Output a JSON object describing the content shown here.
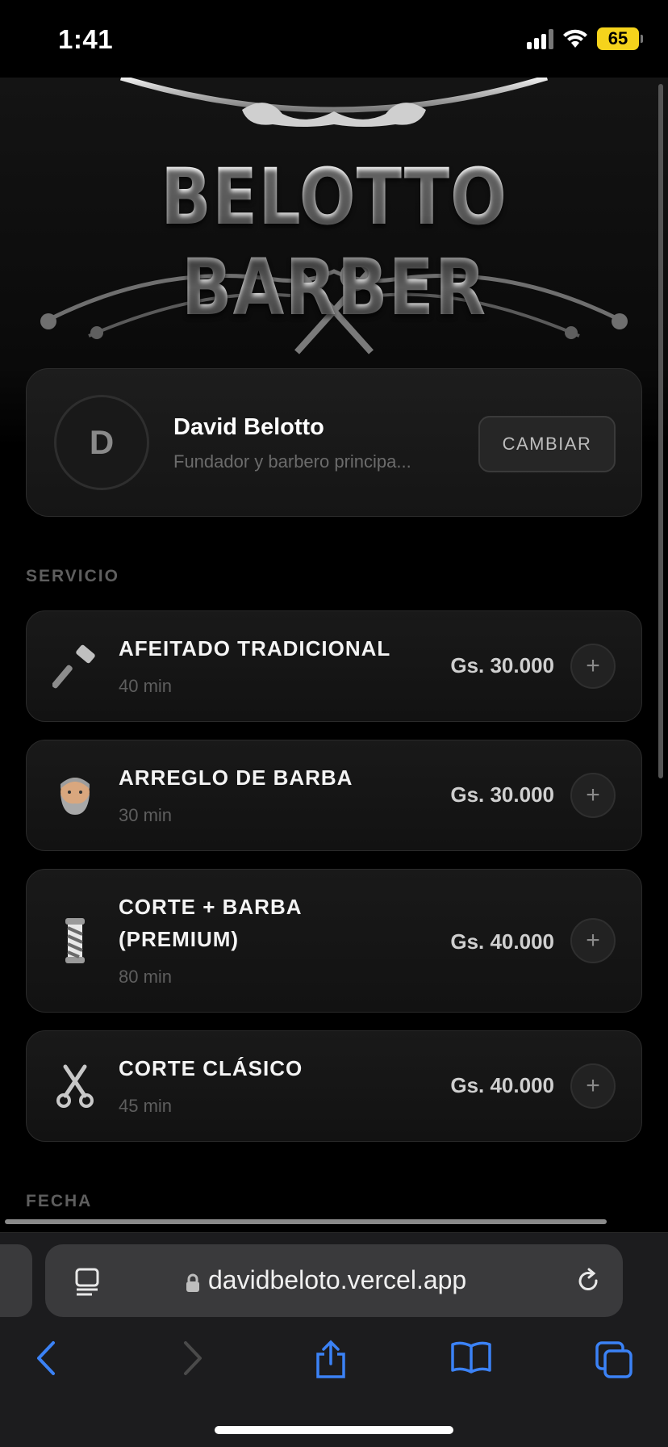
{
  "status_bar": {
    "time": "1:41",
    "battery": "65"
  },
  "hero": {
    "title": "BELOTTO BARBER"
  },
  "barber": {
    "initial": "D",
    "name": "David Belotto",
    "role": "Fundador y barbero principa...",
    "change_label": "CAMBIAR"
  },
  "sections": {
    "service": "SERVICIO",
    "date": "FECHA"
  },
  "services": [
    {
      "name": "AFEITADO TRADICIONAL",
      "duration": "40 min",
      "price": "Gs. 30.000",
      "icon": "razor-icon",
      "add": "+"
    },
    {
      "name": "ARREGLO DE BARBA",
      "duration": "30 min",
      "price": "Gs. 30.000",
      "icon": "bearded-man-icon",
      "add": "+"
    },
    {
      "name": "CORTE + BARBA (PREMIUM)",
      "duration": "80 min",
      "price": "Gs. 40.000",
      "icon": "barber-pole-icon",
      "add": "+"
    },
    {
      "name": "CORTE CLÁSICO",
      "duration": "45 min",
      "price": "Gs. 40.000",
      "icon": "scissors-icon",
      "add": "+"
    }
  ],
  "browser": {
    "url": "davidbeloto.vercel.app"
  },
  "colors": {
    "accent": "#3b82f6",
    "battery": "#f5d31c",
    "background": "#000000"
  }
}
